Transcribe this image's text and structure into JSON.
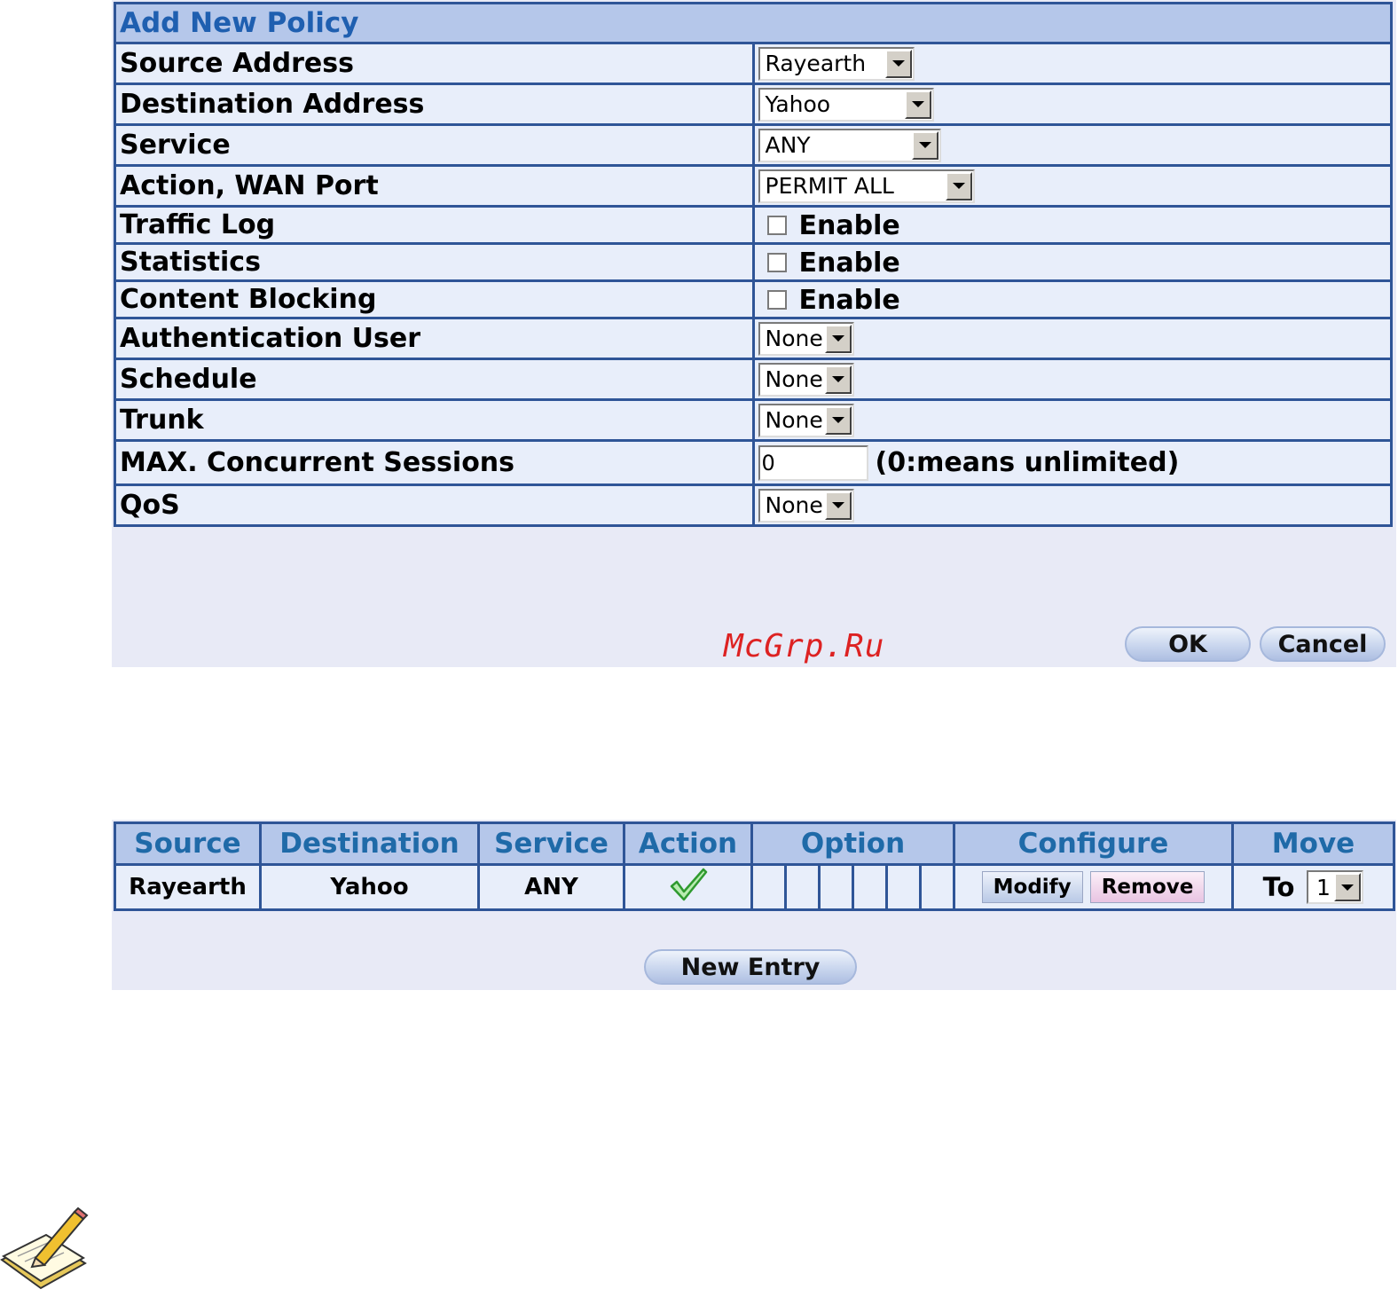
{
  "policy_form": {
    "title": "Add New Policy",
    "rows": [
      {
        "label": "Source Address",
        "type": "select",
        "value": "Rayearth"
      },
      {
        "label": "Destination Address",
        "type": "select",
        "value": "Yahoo"
      },
      {
        "label": "Service",
        "type": "select",
        "value": "ANY"
      },
      {
        "label": "Action, WAN Port",
        "type": "select",
        "value": "PERMIT ALL"
      },
      {
        "label": "Traffic Log",
        "type": "checkbox",
        "value": "Enable",
        "checked": false
      },
      {
        "label": "Statistics",
        "type": "checkbox",
        "value": "Enable",
        "checked": false
      },
      {
        "label": "Content Blocking",
        "type": "checkbox",
        "value": "Enable",
        "checked": false
      },
      {
        "label": "Authentication User",
        "type": "select",
        "value": "None"
      },
      {
        "label": "Schedule",
        "type": "select",
        "value": "None"
      },
      {
        "label": "Trunk",
        "type": "select",
        "value": "None"
      },
      {
        "label": "MAX. Concurrent Sessions",
        "type": "text",
        "value": "0",
        "hint": "(0:means unlimited)"
      },
      {
        "label": "QoS",
        "type": "select",
        "value": "None"
      }
    ],
    "ok_label": "OK",
    "cancel_label": "Cancel"
  },
  "watermark": "McGrp.Ru",
  "policy_list": {
    "headers": [
      "Source",
      "Destination",
      "Service",
      "Action",
      "Option",
      "Configure",
      "Move"
    ],
    "rows": [
      {
        "source": "Rayearth",
        "destination": "Yahoo",
        "service": "ANY",
        "action_icon": "checkmark-icon",
        "modify_label": "Modify",
        "remove_label": "Remove",
        "move_label": "To",
        "move_value": "1"
      }
    ],
    "new_entry_label": "New Entry"
  },
  "colors": {
    "header_bg": "#b5c7ea",
    "border": "#2f5597",
    "title_text": "#1f5fb0",
    "panel_bg": "#e8eaf6",
    "check_green": "#3cb43c",
    "watermark": "#dd2222"
  }
}
